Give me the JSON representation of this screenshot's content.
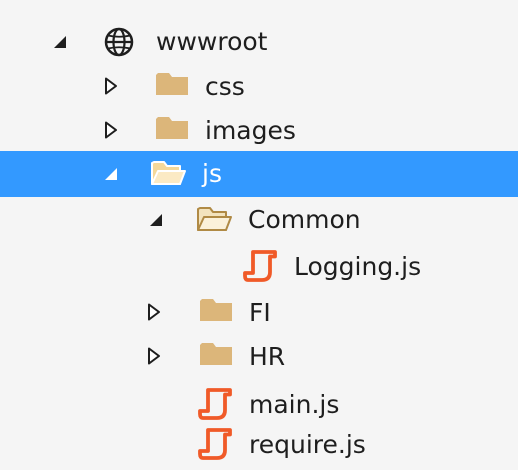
{
  "tree": {
    "colors": {
      "selection": "#3399ff",
      "folder": "#dcb67a",
      "folder_open_outline": "#b08a45",
      "script": "#f05a28",
      "expander": "#1e1e1e"
    },
    "nodes": [
      {
        "id": "wwwroot",
        "label": "wwwroot",
        "icon": "globe-icon",
        "expander": "expanded"
      },
      {
        "id": "css",
        "label": "css",
        "icon": "folder-icon",
        "expander": "collapsed"
      },
      {
        "id": "images",
        "label": "images",
        "icon": "folder-icon",
        "expander": "collapsed"
      },
      {
        "id": "js",
        "label": "js",
        "icon": "folder-open-icon",
        "expander": "expanded",
        "selected": true
      },
      {
        "id": "common",
        "label": "Common",
        "icon": "folder-open-icon",
        "expander": "expanded"
      },
      {
        "id": "logging",
        "label": "Logging.js",
        "icon": "javascript-file-icon"
      },
      {
        "id": "fi",
        "label": "FI",
        "icon": "folder-icon",
        "expander": "collapsed"
      },
      {
        "id": "hr",
        "label": "HR",
        "icon": "folder-icon",
        "expander": "collapsed"
      },
      {
        "id": "main",
        "label": "main.js",
        "icon": "javascript-file-icon"
      },
      {
        "id": "require",
        "label": "require.js",
        "icon": "javascript-file-icon"
      }
    ]
  }
}
